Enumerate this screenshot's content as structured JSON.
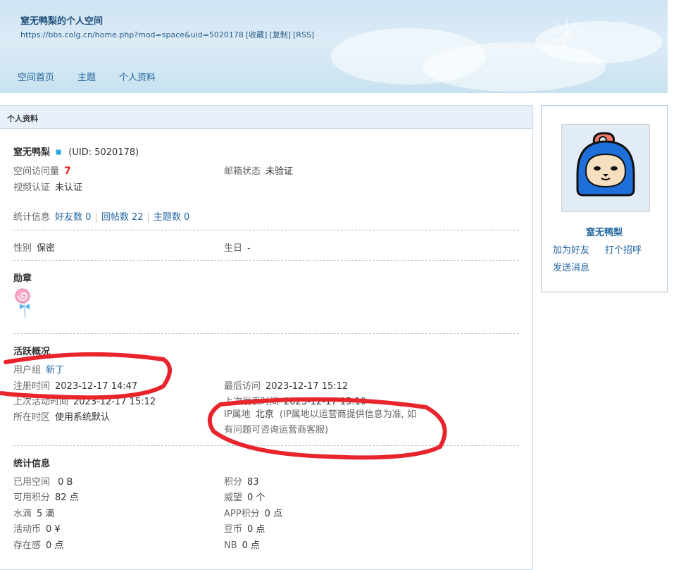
{
  "header": {
    "title": "窒无鸭梨的个人空间",
    "url": "https://bbs.colg.cn/home.php?mod=space&uid=5020178",
    "actions": [
      "[收藏]",
      "[复制]",
      "[RSS]"
    ],
    "nav": [
      "空间首页",
      "主题",
      "个人资料"
    ]
  },
  "profile": {
    "section_title": "个人资料",
    "username": "窒无鸭梨",
    "uid": "(UID: 5020178)",
    "visits_label": "空间访问量",
    "visits_value": "7",
    "email_label": "邮箱状态",
    "email_value": "未验证",
    "video_label": "视频认证",
    "video_value": "未认证",
    "stats_label": "统计信息",
    "stats_links": [
      "好友数 0",
      "回帖数 22",
      "主题数 0"
    ],
    "gender_label": "性别",
    "gender_value": "保密",
    "birthday_label": "生日",
    "birthday_value": "-",
    "medals_title": "勋章",
    "activity_title": "活跃概况",
    "usergroup_label": "用户组",
    "usergroup_value": "新丁",
    "register_label": "注册时间",
    "register_value": "2023-12-17 14:47",
    "last_visit_label": "最后访问",
    "last_visit_value": "2023-12-17 15:12",
    "last_active_label": "上次活动时间",
    "last_active_value": "2023-12-17 15:12",
    "last_post_label": "上次发表时间",
    "last_post_value": "2023-12-17 15:10",
    "timezone_label": "所在时区",
    "timezone_value": "使用系统默认",
    "ip_label": "IP属地",
    "ip_value": "北京",
    "ip_note_1": "(IP属地以运营商提供信息为准, 如",
    "ip_note_2": "有问题可咨询运营商客服)",
    "stats_title": "统计信息",
    "stats": {
      "used_space_label": "已用空间",
      "used_space_value": "0 B",
      "points_label": "积分",
      "points_value": "83",
      "avail_points_label": "可用积分",
      "avail_points_value": "82 点",
      "prestige_label": "威望",
      "prestige_value": "0 个",
      "water_label": "水滴",
      "water_value": "5 滴",
      "app_points_label": "APP积分",
      "app_points_value": "0 点",
      "coin_label": "活动币",
      "coin_value": "0 ¥",
      "bean_label": "豆币",
      "bean_value": "0 点",
      "presence_label": "存在感",
      "presence_value": "0 点",
      "nb_label": "NB",
      "nb_value": "0 点"
    }
  },
  "sidebar": {
    "name": "窒无鸭梨",
    "add_friend": "加为好友",
    "greet": "打个招呼",
    "message": "发送消息"
  },
  "colors": {
    "accent": "#2366a0",
    "highlight": "#e21d1d",
    "annotation": "#e8242c"
  }
}
